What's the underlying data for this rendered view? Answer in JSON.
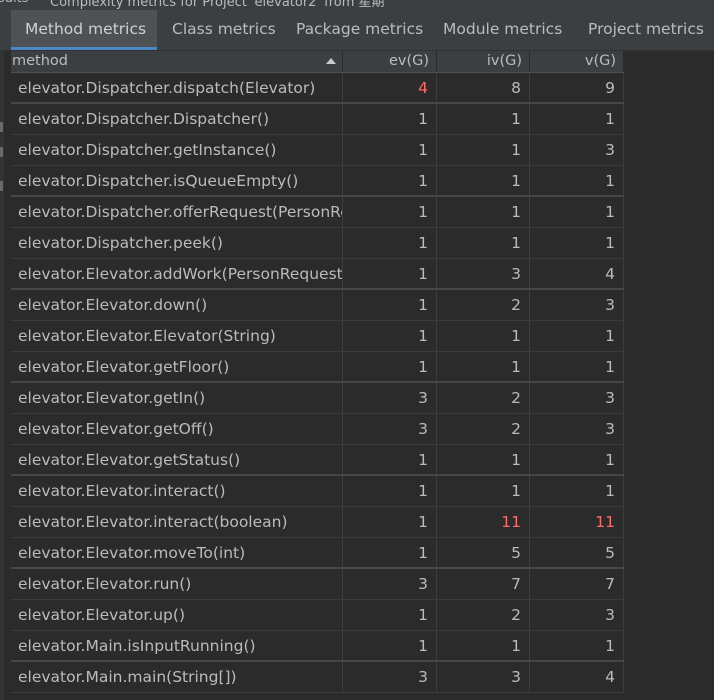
{
  "colors": {
    "accent": "#4a88c7",
    "warning": "#ff6b68"
  },
  "top_strip": {
    "fragments": [
      "sults",
      "Complexity metrics for Project 'elevator2' from 星期"
    ]
  },
  "tabs": [
    {
      "label": "Method metrics",
      "active": true
    },
    {
      "label": "Class metrics",
      "active": false
    },
    {
      "label": "Package metrics",
      "active": false
    },
    {
      "label": "Module metrics",
      "active": false
    },
    {
      "label": "Project metrics",
      "active": false
    }
  ],
  "table": {
    "columns": {
      "method": "method",
      "ev": "ev(G)",
      "iv": "iv(G)",
      "v": "v(G)"
    },
    "sort_icon": "sort-ascending-icon",
    "rows": [
      {
        "method": "elevator.Dispatcher.dispatch(Elevator)",
        "ev": "4",
        "iv": "8",
        "v": "9",
        "hot": [
          "ev"
        ]
      },
      {
        "method": "elevator.Dispatcher.Dispatcher()",
        "ev": "1",
        "iv": "1",
        "v": "1",
        "hot": []
      },
      {
        "method": "elevator.Dispatcher.getInstance()",
        "ev": "1",
        "iv": "1",
        "v": "3",
        "hot": []
      },
      {
        "method": "elevator.Dispatcher.isQueueEmpty()",
        "ev": "1",
        "iv": "1",
        "v": "1",
        "hot": []
      },
      {
        "method": "elevator.Dispatcher.offerRequest(PersonReq",
        "ev": "1",
        "iv": "1",
        "v": "1",
        "hot": []
      },
      {
        "method": "elevator.Dispatcher.peek()",
        "ev": "1",
        "iv": "1",
        "v": "1",
        "hot": []
      },
      {
        "method": "elevator.Elevator.addWork(PersonRequest)",
        "ev": "1",
        "iv": "3",
        "v": "4",
        "hot": []
      },
      {
        "method": "elevator.Elevator.down()",
        "ev": "1",
        "iv": "2",
        "v": "3",
        "hot": []
      },
      {
        "method": "elevator.Elevator.Elevator(String)",
        "ev": "1",
        "iv": "1",
        "v": "1",
        "hot": []
      },
      {
        "method": "elevator.Elevator.getFloor()",
        "ev": "1",
        "iv": "1",
        "v": "1",
        "hot": []
      },
      {
        "method": "elevator.Elevator.getIn()",
        "ev": "3",
        "iv": "2",
        "v": "3",
        "hot": []
      },
      {
        "method": "elevator.Elevator.getOff()",
        "ev": "3",
        "iv": "2",
        "v": "3",
        "hot": []
      },
      {
        "method": "elevator.Elevator.getStatus()",
        "ev": "1",
        "iv": "1",
        "v": "1",
        "hot": []
      },
      {
        "method": "elevator.Elevator.interact()",
        "ev": "1",
        "iv": "1",
        "v": "1",
        "hot": []
      },
      {
        "method": "elevator.Elevator.interact(boolean)",
        "ev": "1",
        "iv": "11",
        "v": "11",
        "hot": [
          "iv",
          "v"
        ]
      },
      {
        "method": "elevator.Elevator.moveTo(int)",
        "ev": "1",
        "iv": "5",
        "v": "5",
        "hot": []
      },
      {
        "method": "elevator.Elevator.run()",
        "ev": "3",
        "iv": "7",
        "v": "7",
        "hot": []
      },
      {
        "method": "elevator.Elevator.up()",
        "ev": "1",
        "iv": "2",
        "v": "3",
        "hot": []
      },
      {
        "method": "elevator.Main.isInputRunning()",
        "ev": "1",
        "iv": "1",
        "v": "1",
        "hot": []
      },
      {
        "method": "elevator.Main.main(String[])",
        "ev": "3",
        "iv": "3",
        "v": "4",
        "hot": []
      }
    ]
  }
}
